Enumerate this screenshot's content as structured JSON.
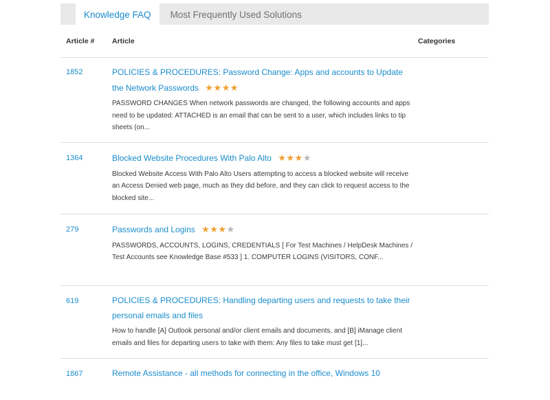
{
  "tabs": [
    {
      "label": "Knowledge FAQ",
      "active": true
    },
    {
      "label": "Most Frequently Used Solutions",
      "active": false
    }
  ],
  "table": {
    "headers": {
      "article_num": "Article #",
      "article": "Article",
      "categories": "Categories"
    },
    "rows": [
      {
        "number": "1852",
        "title": "POLICIES & PROCEDURES: Password Change: Apps and accounts to Update the Network Passwords",
        "rating": 4,
        "excerpt": "PASSWORD CHANGES When network passwords are changed, the following accounts and apps need to be updated: ATTACHED is an email that can be sent to a user, which includes links to tip sheets (on..."
      },
      {
        "number": "1364",
        "title": "Blocked Website Procedures With Palo Alto",
        "rating": 3,
        "excerpt": "Blocked Website Access With Palo Alto Users attempting to access a blocked website will receive an Access Denied web page, much as they did before, and they can click to request access to the blocked site..."
      },
      {
        "number": "279",
        "title": "Passwords and Logins",
        "rating": 3,
        "excerpt": "PASSWORDS, ACCOUNTS, LOGINS, CREDENTIALS [ For Test Machines / HelpDesk Machines / Test Accounts see Knowledge Base #533 ] 1. COMPUTER LOGINS (VISITORS, CONF..."
      },
      {
        "number": "619",
        "title": "POLICIES & PROCEDURES: Handling departing users and requests to take their personal emails and files",
        "rating": 0,
        "excerpt": "How to handle [A] Outlook personal and/or client emails and documents, and [B] iManage client emails and files for departing users to take with them: Any files to take must get [1]..."
      },
      {
        "number": "1867",
        "title": "Remote Assistance - all methods for connecting in the office, Windows 10",
        "rating": 0,
        "excerpt": ""
      }
    ]
  },
  "colors": {
    "link": "#1a8ccc",
    "star_on": "#f0a030",
    "star_off": "#b8b8b8",
    "tabbar": "#e9e9e9"
  }
}
